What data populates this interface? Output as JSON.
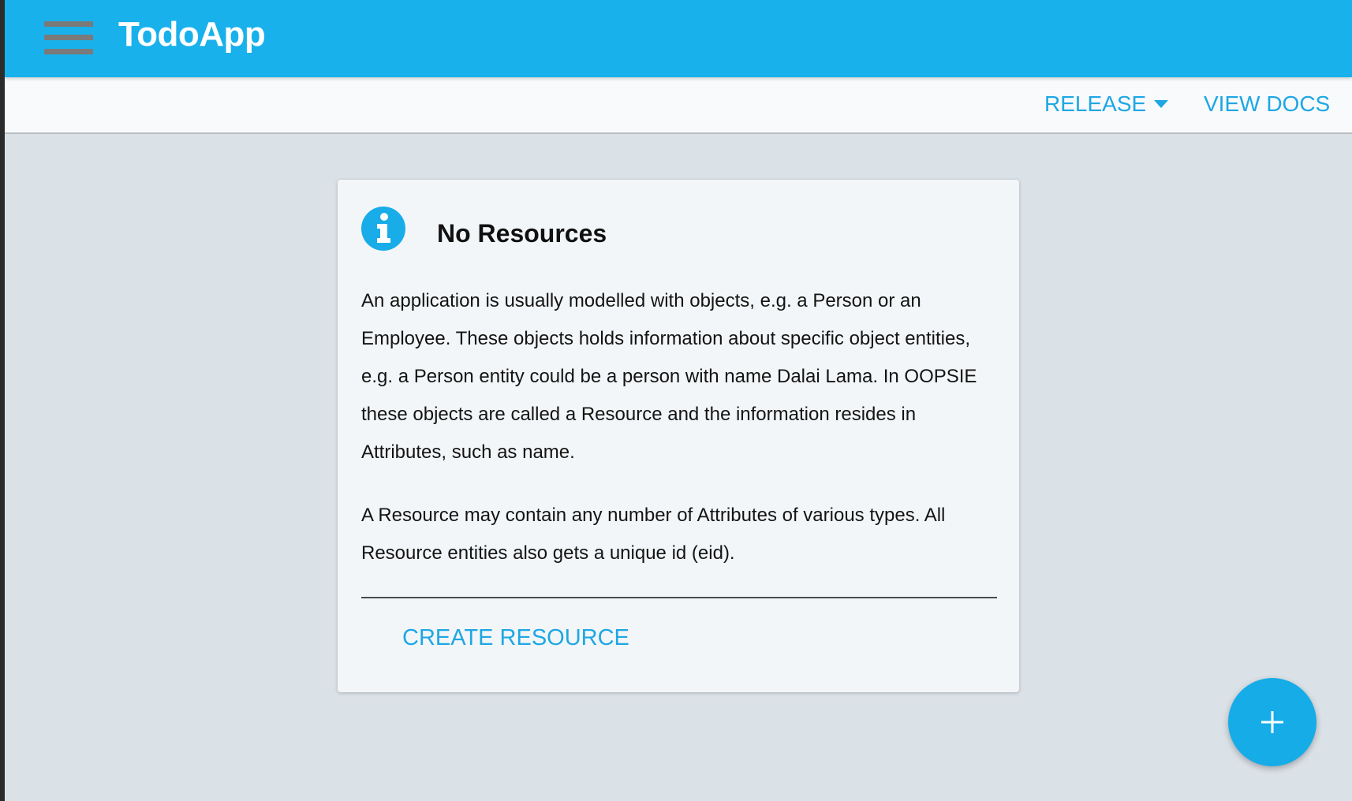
{
  "app": {
    "title": "TodoApp",
    "brand_color": "#18b1ec",
    "menu_icon": "hamburger-menu-icon"
  },
  "toolbar": {
    "release_label": "RELEASE",
    "release_icon": "caret-down-icon",
    "docs_label": "VIEW DOCS",
    "accent_color": "#1ea7e4"
  },
  "card": {
    "icon": "info-icon",
    "title": "No Resources",
    "paragraph1": "An application is usually modelled with objects, e.g. a Person or an Employee. These objects holds information about specific object entities, e.g. a Person entity could be a person with name Dalai Lama. In OOPSIE these objects are called a Resource and the information resides in Attributes, such as name.",
    "paragraph2": "A Resource may contain any number of Attributes of various types. All Resource entities also gets a unique id (eid).",
    "action_label": "CREATE RESOURCE"
  },
  "fab": {
    "icon": "plus-icon"
  }
}
